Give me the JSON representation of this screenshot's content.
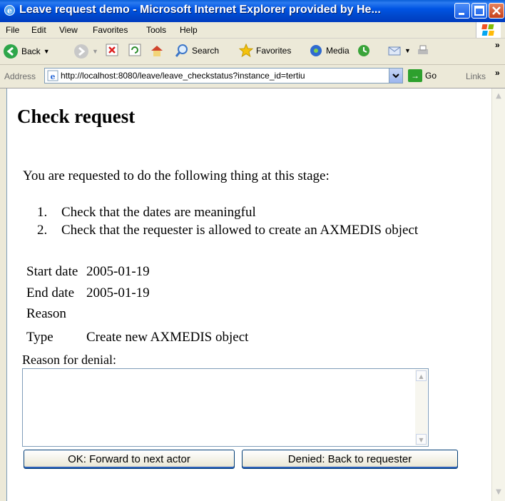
{
  "window": {
    "title": "Leave request demo - Microsoft Internet Explorer provided by He..."
  },
  "menu": {
    "items": [
      {
        "label": "File"
      },
      {
        "label": "Edit"
      },
      {
        "label": "View"
      },
      {
        "label": "Favorites"
      },
      {
        "label": "Tools"
      },
      {
        "label": "Help"
      }
    ]
  },
  "toolbar": {
    "back_label": "Back",
    "search_label": "Search",
    "favorites_label": "Favorites",
    "media_label": "Media"
  },
  "address": {
    "label": "Address",
    "url": "http://localhost:8080/leave/leave_checkstatus?instance_id=tertiu",
    "go_label": "Go",
    "links_label": "Links"
  },
  "page": {
    "heading": "Check request",
    "intro": "You are requested to do the following thing at this stage:",
    "steps": [
      {
        "num": "1.",
        "text": "Check that the dates are meaningful"
      },
      {
        "num": "2.",
        "text": "Check that the requester is allowed to create an AXMEDIS object"
      }
    ],
    "fields": [
      {
        "label": "Start date",
        "value": "2005-01-19"
      },
      {
        "label": "End date",
        "value": "2005-01-19"
      },
      {
        "label": "Reason",
        "value": ""
      },
      {
        "label": "Type",
        "value": "Create new AXMEDIS object"
      }
    ],
    "denial_label": "Reason for denial:",
    "ok_button": "OK: Forward to next actor",
    "denied_button": "Denied: Back to requester"
  },
  "colors": {
    "titlebar": "#0054e3",
    "chrome": "#ece9d8",
    "button_border": "#003c74"
  }
}
